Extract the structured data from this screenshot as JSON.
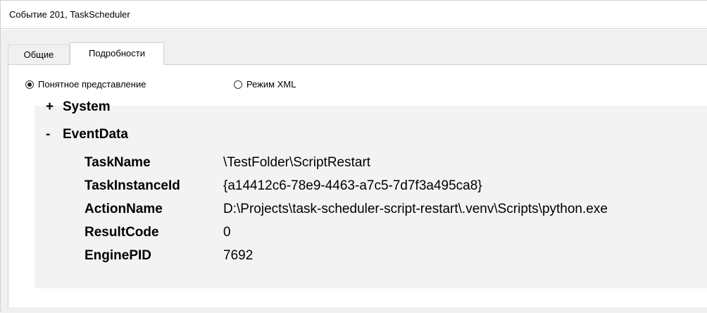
{
  "window": {
    "title": "Событие 201, TaskScheduler"
  },
  "tabs": [
    {
      "label": "Общие",
      "active": false
    },
    {
      "label": "Подробности",
      "active": true
    }
  ],
  "view_mode": {
    "options": [
      {
        "label": "Понятное представление",
        "selected": true
      },
      {
        "label": "Режим XML",
        "selected": false
      }
    ]
  },
  "tree": {
    "system": {
      "toggle": "+",
      "label": "System",
      "expanded": false
    },
    "event_data": {
      "toggle": "-",
      "label": "EventData",
      "expanded": true,
      "fields": [
        {
          "key": "TaskName",
          "value": "\\TestFolder\\ScriptRestart"
        },
        {
          "key": "TaskInstanceId",
          "value": "{a14412c6-78e9-4463-a7c5-7d7f3a495ca8}"
        },
        {
          "key": "ActionName",
          "value": "D:\\Projects\\task-scheduler-script-restart\\.venv\\Scripts\\python.exe"
        },
        {
          "key": "ResultCode",
          "value": "0"
        },
        {
          "key": "EnginePID",
          "value": "7692"
        }
      ]
    }
  },
  "colors": {
    "panel_bg": "#f0f0f0",
    "content_bg": "#f3f3f3",
    "border": "#d9d9d9"
  }
}
